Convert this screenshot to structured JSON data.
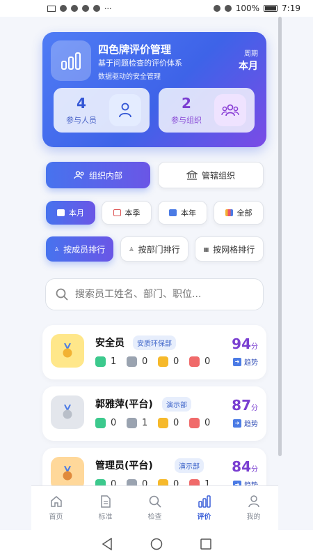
{
  "status_bar": {
    "left_icons": "HD 4G wifi",
    "battery": "100%",
    "time": "7:19"
  },
  "hero": {
    "title": "四色牌评价管理",
    "subtitle": "基于问题检查的评价体系",
    "subtitle2": "数据驱动的安全管理",
    "period_label": "周期",
    "period_value": "本月",
    "stats": [
      {
        "value": "4",
        "label": "参与人员",
        "icon": "person-icon"
      },
      {
        "value": "2",
        "label": "参与组织",
        "icon": "group-icon"
      }
    ]
  },
  "scope_tabs": [
    {
      "label": "组织内部",
      "icon": "people-icon",
      "active": true
    },
    {
      "label": "管辖组织",
      "icon": "bank-icon",
      "active": false
    }
  ],
  "period_filters": [
    {
      "label": "本月",
      "icon": "calendar-icon",
      "active": true
    },
    {
      "label": "本季",
      "icon": "chart-icon",
      "active": false
    },
    {
      "label": "本年",
      "icon": "calendar-icon",
      "active": false
    },
    {
      "label": "全部",
      "icon": "bar-chart-icon",
      "active": false
    }
  ],
  "rank_tabs": [
    {
      "label": "按成员排行",
      "active": true
    },
    {
      "label": "按部门排行",
      "active": false
    },
    {
      "label": "按网格排行",
      "active": false
    }
  ],
  "search": {
    "placeholder": "搜索员工姓名、部门、职位..."
  },
  "colors": {
    "green": "#3cc98d",
    "gray": "#9aa3b0",
    "yellow": "#f6b92b",
    "red": "#f06a6a",
    "accent": "#4773ee",
    "score": "#7a3fd1"
  },
  "ranking": [
    {
      "rank": "1",
      "name": "安全员",
      "dept": "安质环保部",
      "counts": [
        "1",
        "0",
        "0",
        "0"
      ],
      "score": "94",
      "unit": "分",
      "trend": "趋势"
    },
    {
      "rank": "2",
      "name": "郭雅萍(平台)",
      "dept": "演示部",
      "counts": [
        "0",
        "1",
        "0",
        "0"
      ],
      "score": "87",
      "unit": "分",
      "trend": "趋势"
    },
    {
      "rank": "3",
      "name": "管理员(平台)",
      "dept": "演示部",
      "counts": [
        "0",
        "0",
        "0",
        "1"
      ],
      "score": "84",
      "unit": "分",
      "trend": "趋势"
    }
  ],
  "tabbar": [
    {
      "label": "首页",
      "icon": "home-icon",
      "active": false
    },
    {
      "label": "标准",
      "icon": "document-icon",
      "active": false
    },
    {
      "label": "检查",
      "icon": "search-icon",
      "active": false
    },
    {
      "label": "评价",
      "icon": "bar-chart-icon",
      "active": true
    },
    {
      "label": "我的",
      "icon": "user-icon",
      "active": false
    }
  ]
}
